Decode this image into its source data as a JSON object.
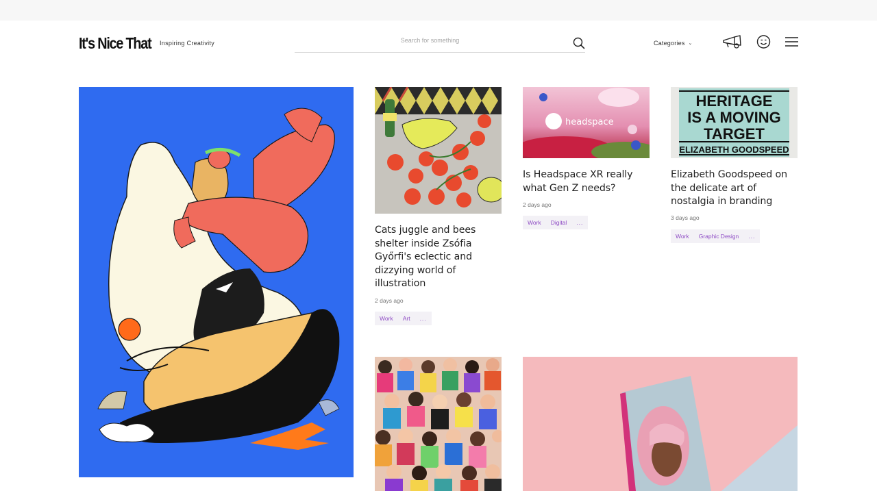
{
  "header": {
    "logo": "It's Nice That",
    "tagline": "Inspiring Creativity",
    "search_placeholder": "Search for something",
    "categories_label": "Categories"
  },
  "icons": {
    "search": "search-icon",
    "megaphone": "megaphone-icon",
    "smiley": "smiley-icon",
    "menu": "hamburger-menu-icon",
    "chevron": "chevron-down-icon"
  },
  "colors": {
    "tag_text": "#8e4bc4",
    "tag_bg": "#f3f1f6",
    "feature_bg": "#2f6bf0"
  },
  "articles": [
    {
      "title": "Cats juggle and bees shelter inside Zsófia Győrfi's eclectic and dizzying world of illustration",
      "date": "2 days ago",
      "tags": [
        "Work",
        "Art",
        "..."
      ]
    },
    {
      "title": "Is Headspace XR really what Gen Z needs?",
      "date": "2 days ago",
      "tags": [
        "Work",
        "Digital",
        "..."
      ],
      "image_text": "headspace"
    },
    {
      "title": "Elizabeth Goodspeed on the delicate art of nostalgia in branding",
      "date": "3 days ago",
      "tags": [
        "Work",
        "Graphic Design",
        "..."
      ],
      "image_text": [
        "HERITAGE",
        "IS A MOVING",
        "TARGET",
        "ELIZABETH GOODSPEED"
      ]
    }
  ]
}
